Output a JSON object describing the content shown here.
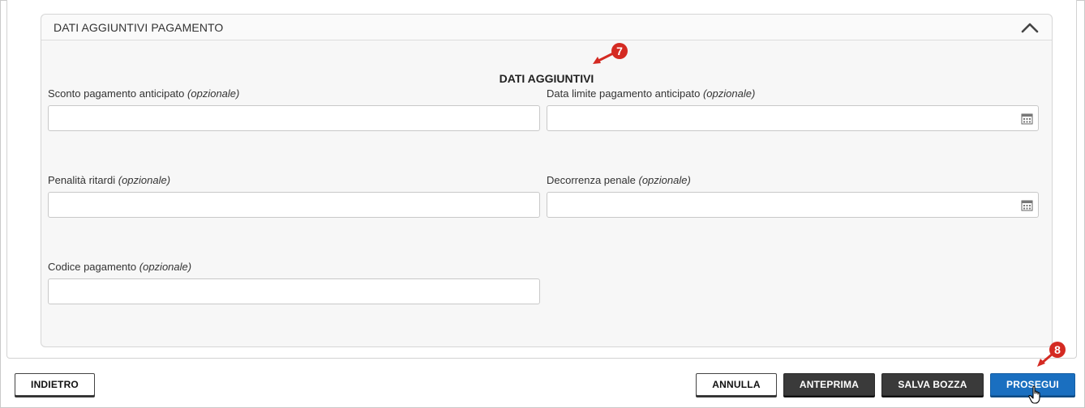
{
  "panel": {
    "title": "DATI AGGIUNTIVI PAGAMENTO",
    "collapse_icon": "chevron-up-icon"
  },
  "section": {
    "heading": "DATI AGGIUNTIVI"
  },
  "fields": {
    "sconto": {
      "label": "Sconto pagamento anticipato",
      "optional": "(opzionale)",
      "value": ""
    },
    "data_limite": {
      "label": "Data limite pagamento anticipato",
      "optional": "(opzionale)",
      "value": "",
      "icon": "calendar-icon"
    },
    "penalita": {
      "label": "Penalità ritardi",
      "optional": "(opzionale)",
      "value": ""
    },
    "decorrenza": {
      "label": "Decorrenza penale",
      "optional": "(opzionale)",
      "value": "",
      "icon": "calendar-icon"
    },
    "codice": {
      "label": "Codice pagamento",
      "optional": "(opzionale)",
      "value": ""
    }
  },
  "annotations": {
    "step7": "7",
    "step8": "8",
    "color": "#d42a22"
  },
  "buttons": {
    "back": "INDIETRO",
    "cancel": "ANNULLA",
    "preview": "ANTEPRIMA",
    "save_draft": "SALVA BOZZA",
    "proceed": "PROSEGUI"
  },
  "colors": {
    "primary": "#1a6fc0",
    "dark_button": "#3a3a3a",
    "panel_bg": "#f7f7f7"
  }
}
